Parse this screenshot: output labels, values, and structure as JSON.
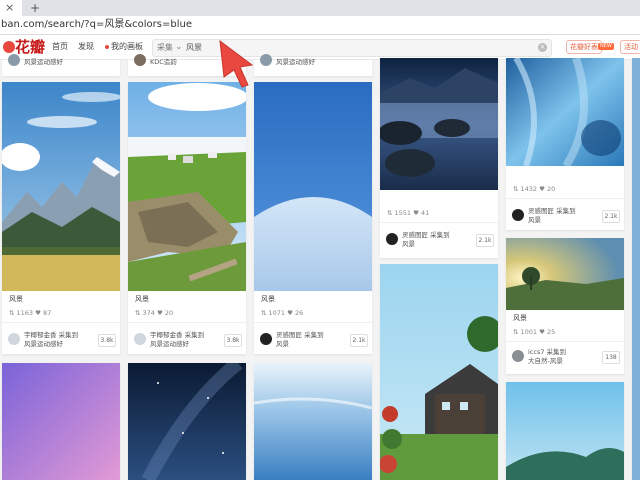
{
  "browser": {
    "tab_close": "×",
    "new_tab": "+",
    "url": "ban.com/search/?q=风景&colors=blue"
  },
  "header": {
    "logo_text": "花瓣",
    "nav": [
      "首页",
      "发现",
      "我的画板"
    ],
    "search": {
      "category": "采集",
      "value": "风景",
      "clear": "×"
    },
    "promo": [
      "花瓣好表",
      "活动"
    ],
    "promo_badge": "NEW"
  },
  "colors": {
    "brand": "#e8483f",
    "accent": "#ff6b3d"
  },
  "cards": [
    {
      "caption": "风景",
      "stats": "⇅ 1163  ♥ 87",
      "user": "宇椰郁金香 采集到",
      "board": "风景运动感好",
      "count": "3.8k"
    },
    {
      "caption": "风景",
      "stats": "⇅ 374  ♥ 20",
      "user": "宇椰郁金香 采集到",
      "board": "风景运动感好",
      "count": "3.8k"
    },
    {
      "caption": "风景",
      "stats": "⇅ 1071  ♥ 26",
      "user": "灵感图匠 采集到",
      "board": "风景",
      "count": "2.1k"
    },
    {
      "caption": "",
      "stats": "⇅ 1551  ♥ 41",
      "user": "灵感图匠 采集到",
      "board": "风景",
      "count": "2.1k"
    },
    {
      "caption": "",
      "stats": "⇅ 1432  ♥ 20",
      "user": "灵感图匠 采集到",
      "board": "风景",
      "count": "2.1k"
    },
    {
      "caption": "风景",
      "stats": "⇅ 1001  ♥ 25",
      "user": "iccs7 采集到",
      "board": "大自然-风景",
      "count": "138"
    }
  ],
  "top_partial": [
    "风景运动感好",
    "KDC造韵",
    "风景运动感好"
  ]
}
